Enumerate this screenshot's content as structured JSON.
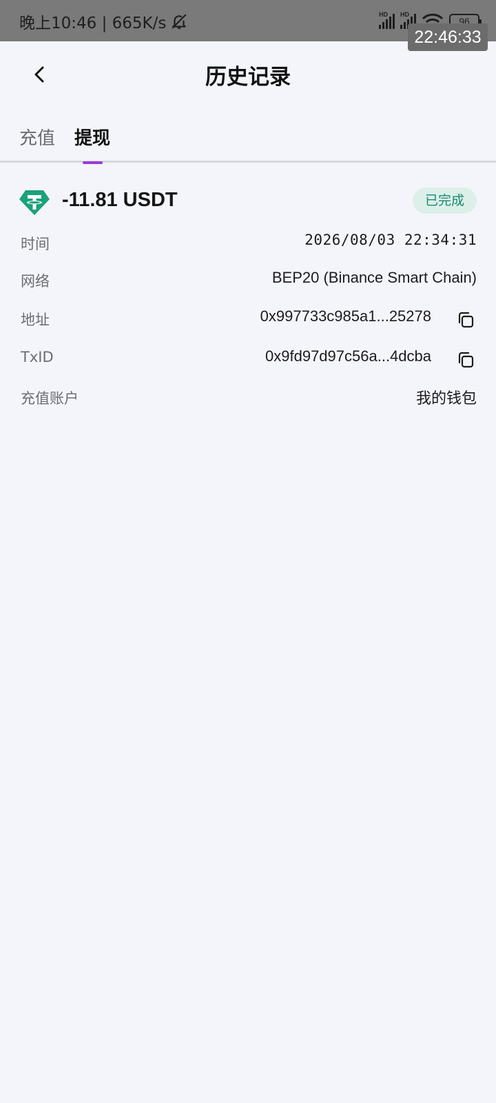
{
  "status_bar": {
    "time_speed": "晚上10:46 | 665K/s",
    "signal_label_1": "HD",
    "signal_label_2": "HD",
    "battery": "96",
    "overlay_clock": "22:46:33"
  },
  "header": {
    "title": "历史记录"
  },
  "tabs": [
    {
      "label": "充值",
      "active": false
    },
    {
      "label": "提现",
      "active": true
    }
  ],
  "record": {
    "amount": "-11.81 USDT",
    "status": "已完成",
    "coin_icon": "tether-icon",
    "accent_color": "#9b3ad9",
    "tether_color": "#1ba27a",
    "details": [
      {
        "label": "时间",
        "value": "2026/08/03 22:34:31",
        "copyable": false
      },
      {
        "label": "网络",
        "value": "BEP20 (Binance Smart Chain)",
        "copyable": false
      },
      {
        "label": "地址",
        "value": "0x997733c985a1...25278",
        "copyable": true
      },
      {
        "label": "TxID",
        "value": "0x9fd97d97c56a...4dcba",
        "copyable": true
      },
      {
        "label": "充值账户",
        "value": "我的钱包",
        "copyable": false
      }
    ]
  }
}
